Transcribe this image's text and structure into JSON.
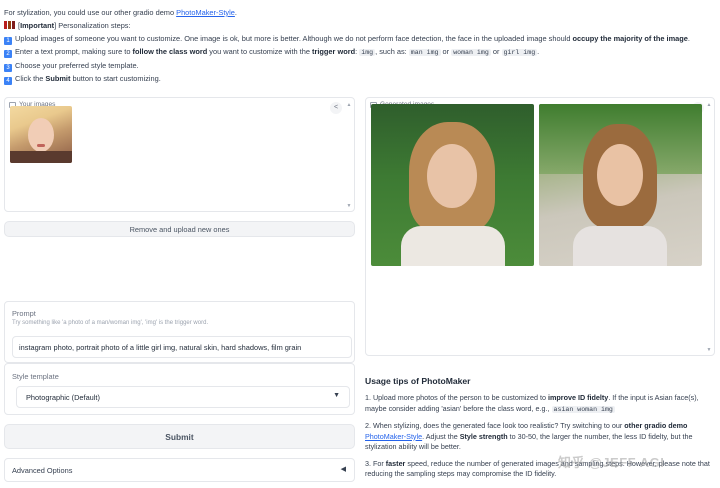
{
  "header": {
    "line1_prefix": "For stylization, you could use our other gradio demo ",
    "line1_link": "PhotoMaker-Style",
    "line1_suffix": ".",
    "important_label": "Important",
    "important_suffix": " Personalization steps:",
    "steps": [
      {
        "num": "1",
        "parts": [
          {
            "t": "Upload images of someone you want to customize. One image is ok, but more is better. Although we do not perform face detection, the face in the uploaded image should "
          },
          {
            "b": "occupy the majority of the image"
          },
          {
            "t": "."
          }
        ]
      },
      {
        "num": "2",
        "parts": [
          {
            "t": "Enter a text prompt, making sure to "
          },
          {
            "b": "follow the class word"
          },
          {
            "t": " you want to customize with the "
          },
          {
            "b": "trigger word"
          },
          {
            "t": ": "
          },
          {
            "c": "img"
          },
          {
            "t": ", such as: "
          },
          {
            "c": "man img"
          },
          {
            "t": " or "
          },
          {
            "c": "woman img"
          },
          {
            "t": " or "
          },
          {
            "c": "girl img"
          },
          {
            "t": "."
          }
        ]
      },
      {
        "num": "3",
        "parts": [
          {
            "t": "Choose your preferred style template."
          }
        ]
      },
      {
        "num": "4",
        "parts": [
          {
            "t": "Click the "
          },
          {
            "b": "Submit"
          },
          {
            "t": " button to start customizing."
          }
        ]
      }
    ]
  },
  "upload_panel": {
    "label": "Your images"
  },
  "remove_button": "Remove and upload new ones",
  "gallery": {
    "label": "Generated images"
  },
  "prompt": {
    "label": "Prompt",
    "hint": "Try something like 'a photo of a man/woman img', 'img' is the trigger word.",
    "value": "instagram photo, portrait photo of a little girl img, natural skin, hard shadows, film grain"
  },
  "style": {
    "label": "Style template",
    "value": "Photographic (Default)"
  },
  "submit": "Submit",
  "advanced": "Advanced Options",
  "tips": {
    "title": "Usage tips of PhotoMaker",
    "items": [
      [
        {
          "t": "1. Upload more photos of the person to be customized to "
        },
        {
          "b": "improve ID fidelty"
        },
        {
          "t": ". If the input is Asian face(s), maybe consider adding 'asian' before the class word, e.g., "
        },
        {
          "c": "asian woman img"
        }
      ],
      [
        {
          "t": "2. When stylizing, does the generated face look too realistic? Try switching to our "
        },
        {
          "b": "other gradio demo"
        },
        {
          "t": " "
        },
        {
          "a": "PhotoMaker-Style"
        },
        {
          "t": ". Adjust the "
        },
        {
          "b": "Style strength"
        },
        {
          "t": " to 30-50, the larger the number, the less ID fidelty, but the stylization ability will be better."
        }
      ],
      [
        {
          "t": "3. For "
        },
        {
          "b": "faster"
        },
        {
          "t": " speed, reduce the number of generated images and sampling steps. However, please note that reducing the sampling steps may compromise the ID fidelity."
        }
      ]
    ]
  },
  "watermark": "知乎 @JEFF AGI",
  "colors": {
    "accent": "#3b82f6",
    "link": "#2563eb"
  }
}
